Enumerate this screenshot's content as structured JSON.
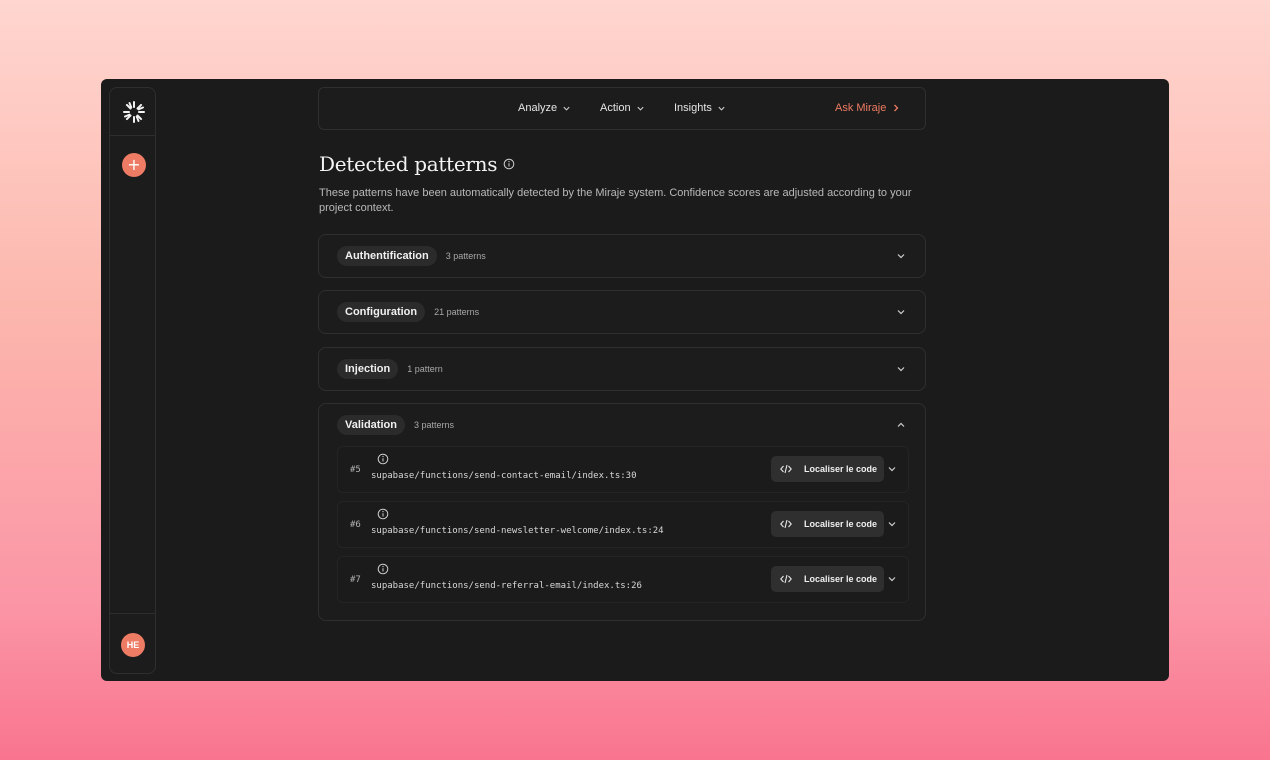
{
  "nav": {
    "items": [
      "Analyze",
      "Action",
      "Insights"
    ],
    "ask_label": "Ask Miraje"
  },
  "sidebar": {
    "add_icon": "+",
    "avatar_initials": "HE"
  },
  "page": {
    "title": "Detected patterns",
    "description": "These patterns have been automatically detected by the Miraje system. Confidence scores are adjusted according to your project context."
  },
  "groups": [
    {
      "name": "Authentification",
      "count": "3 patterns",
      "expanded": false
    },
    {
      "name": "Configuration",
      "count": "21 patterns",
      "expanded": false
    },
    {
      "name": "Injection",
      "count": "1 pattern",
      "expanded": false
    },
    {
      "name": "Validation",
      "count": "3 patterns",
      "expanded": true
    }
  ],
  "validation_items": [
    {
      "num": "#5",
      "path": "supabase/functions/send-contact-email/index.ts:30",
      "button": "Localiser le code"
    },
    {
      "num": "#6",
      "path": "supabase/functions/send-newsletter-welcome/index.ts:24",
      "button": "Localiser le code"
    },
    {
      "num": "#7",
      "path": "supabase/functions/send-referral-email/index.ts:26",
      "button": "Localiser le code"
    }
  ],
  "colors": {
    "accent": "#ee7b63",
    "background": "#1b1b1b"
  }
}
